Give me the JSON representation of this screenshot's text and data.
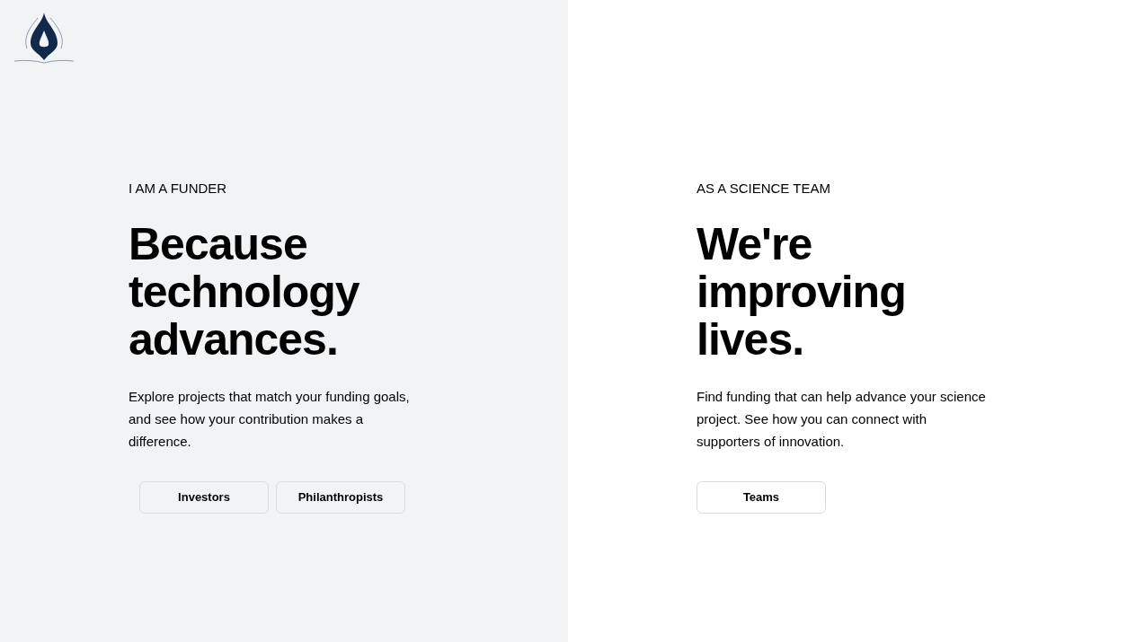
{
  "panels": [
    {
      "eyebrow": "I AM A FUNDER",
      "headline": [
        "Because",
        "technology",
        "advances."
      ],
      "text": "Explore projects that match your funding goals, and see how your contribution makes a difference.",
      "buttons": [
        "Investors",
        "Philanthropists"
      ]
    },
    {
      "eyebrow": "AS A SCIENCE TEAM",
      "headline": [
        "We're",
        "improving",
        "lives."
      ],
      "text": "Find funding that can help advance your science project. See how you can connect with supporters of innovation.",
      "buttons": [
        "Teams"
      ]
    }
  ]
}
